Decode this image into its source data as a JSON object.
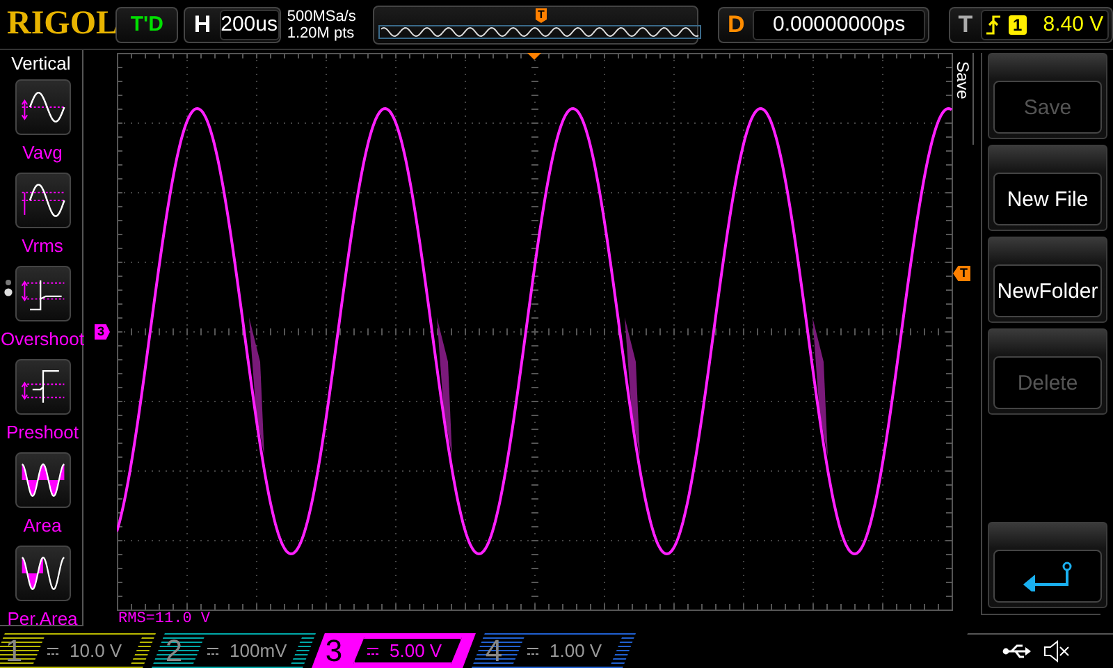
{
  "top_bar": {
    "logo": "RIGOL",
    "run_status": "T'D",
    "horizontal": {
      "label": "H",
      "timebase": "200us"
    },
    "acquisition": {
      "sample_rate": "500MSa/s",
      "memory_depth": "1.20M pts"
    },
    "overview": {
      "trigger_marker": "T"
    },
    "delay": {
      "label": "D",
      "value": "0.00000000ps"
    },
    "trigger": {
      "label": "T",
      "source": "1",
      "level": "8.40 V"
    }
  },
  "measure_menu": {
    "title": "Vertical",
    "items": [
      {
        "label": "Vavg",
        "kind": "vavg"
      },
      {
        "label": "Vrms",
        "kind": "vrms"
      },
      {
        "label": "Overshoot",
        "kind": "overshoot"
      },
      {
        "label": "Preshoot",
        "kind": "preshoot"
      },
      {
        "label": "Area",
        "kind": "area"
      },
      {
        "label": "Per.Area",
        "kind": "per_area"
      }
    ]
  },
  "screen": {
    "channel_marker": "3",
    "trigger_marker": "T",
    "measurement": "RMS=11.0 V"
  },
  "softkey_menu": {
    "title": "Save",
    "buttons": [
      {
        "kind": "text",
        "label": "Save",
        "disabled": true
      },
      {
        "kind": "text",
        "label": "New File",
        "disabled": false
      },
      {
        "kind": "text",
        "label": "NewFolder",
        "disabled": false
      },
      {
        "kind": "text",
        "label": "Delete",
        "disabled": true
      },
      {
        "kind": "spacer"
      },
      {
        "kind": "back"
      }
    ]
  },
  "channels": [
    {
      "number": "1",
      "scale": "10.0 V",
      "color": "#b8b800",
      "selected": false
    },
    {
      "number": "2",
      "scale": "100mV",
      "color": "#00a8a8",
      "selected": false
    },
    {
      "number": "3",
      "scale": "5.00 V",
      "color": "#ff00ff",
      "selected": true
    },
    {
      "number": "4",
      "scale": "1.00 V",
      "color": "#2060d0",
      "selected": false
    }
  ]
}
